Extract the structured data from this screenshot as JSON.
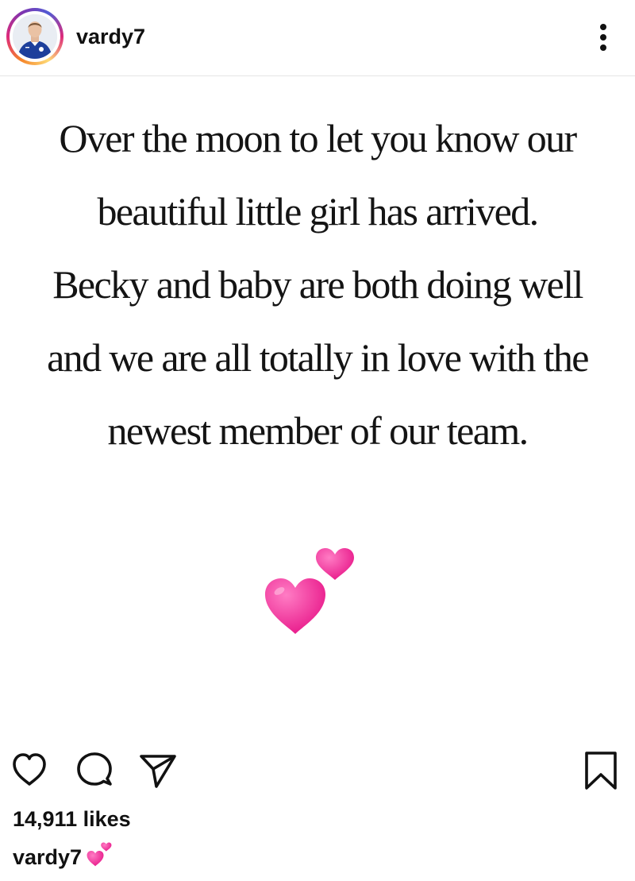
{
  "header": {
    "username": "vardy7",
    "avatar_icon": "profile-photo-avatar",
    "more_icon": "more-options-vertical-icon"
  },
  "post": {
    "lines": [
      "Over the moon to let you know our",
      "beautiful little girl has arrived.",
      "Becky and baby are both doing well",
      "and we are all totally in love with the",
      "newest member of our team."
    ],
    "emoji": "two-hearts-emoji",
    "emoji_color": "#f0379c",
    "background": "#ffffff"
  },
  "actions": {
    "like_icon": "heart-outline-icon",
    "comment_icon": "comment-icon",
    "share_icon": "send-icon",
    "save_icon": "bookmark-icon"
  },
  "likes": "14,911 likes",
  "caption": {
    "username": "vardy7",
    "emoji": "two-hearts-emoji"
  }
}
